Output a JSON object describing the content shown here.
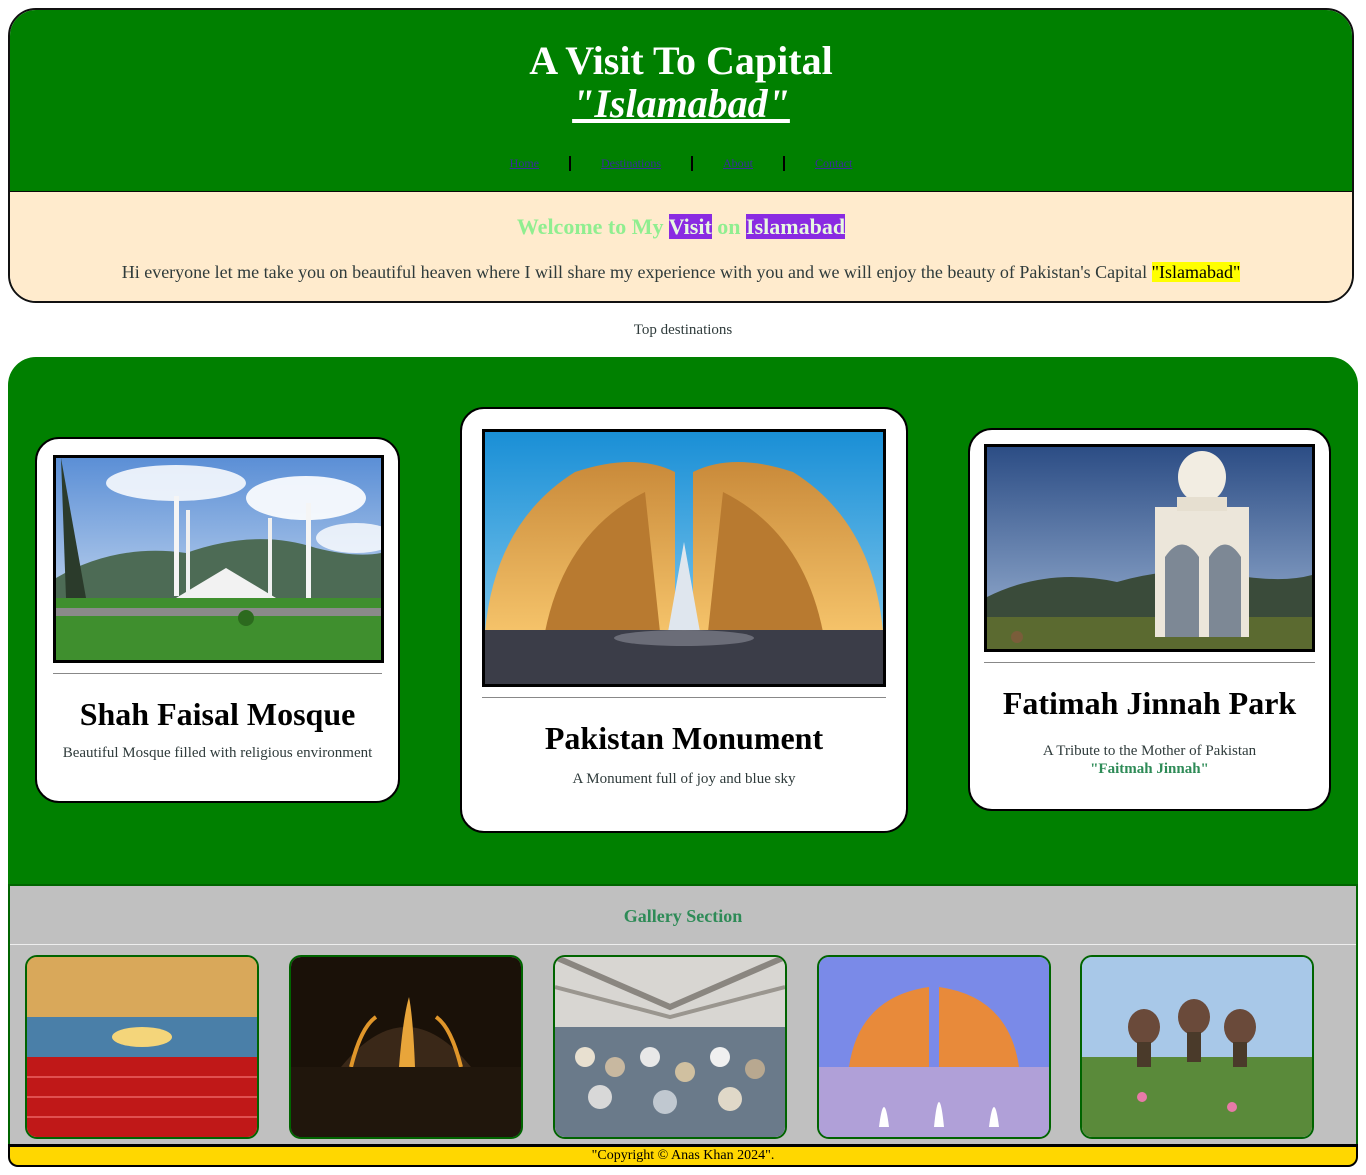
{
  "header": {
    "title": "A Visit To Capital",
    "subtitle": "\"Islamabad\"",
    "nav": [
      "Home",
      "Destinations",
      "About",
      "Contact"
    ]
  },
  "intro": {
    "welcome_prefix": "Welcome to My",
    "welcome_word1": "Visit",
    "welcome_mid": "on",
    "welcome_word2": "Islamabad",
    "text": "Hi everyone let me take you on beautiful heaven where I will share my experience with you and we will enjoy the beauty of Pakistan's Capital",
    "highlight": "\"Islamabad\""
  },
  "top_destinations_label": "Top destinations",
  "destinations": [
    {
      "title": "Shah Faisal Mosque",
      "desc": "Beautiful Mosque filled with religious environment",
      "image_icon": "faisal-mosque-image"
    },
    {
      "title": "Pakistan Monument",
      "desc": "A Monument full of joy and blue sky",
      "image_icon": "pakistan-monument-image"
    },
    {
      "title": "Fatimah Jinnah Park",
      "desc": "A Tribute to the Mother of Pakistan",
      "emphasis": "\"Faitmah Jinnah\"",
      "image_icon": "fatimah-jinnah-park-image"
    }
  ],
  "gallery": {
    "title": "Gallery Section",
    "images": [
      "mosque-interior-image",
      "monument-night-image",
      "prayer-hall-image",
      "monument-fountain-image",
      "park-domes-image"
    ]
  },
  "footer": {
    "text": "\"Copyright © Anas Khan 2024\"."
  },
  "colors": {
    "banner_green": "#008000",
    "intro_bg": "#ffebcd",
    "highlight_purple": "#8a2be2",
    "highlight_yellow": "#ffff00",
    "gallery_bg": "#c0c0c0",
    "footer_bg": "#ffd700"
  }
}
